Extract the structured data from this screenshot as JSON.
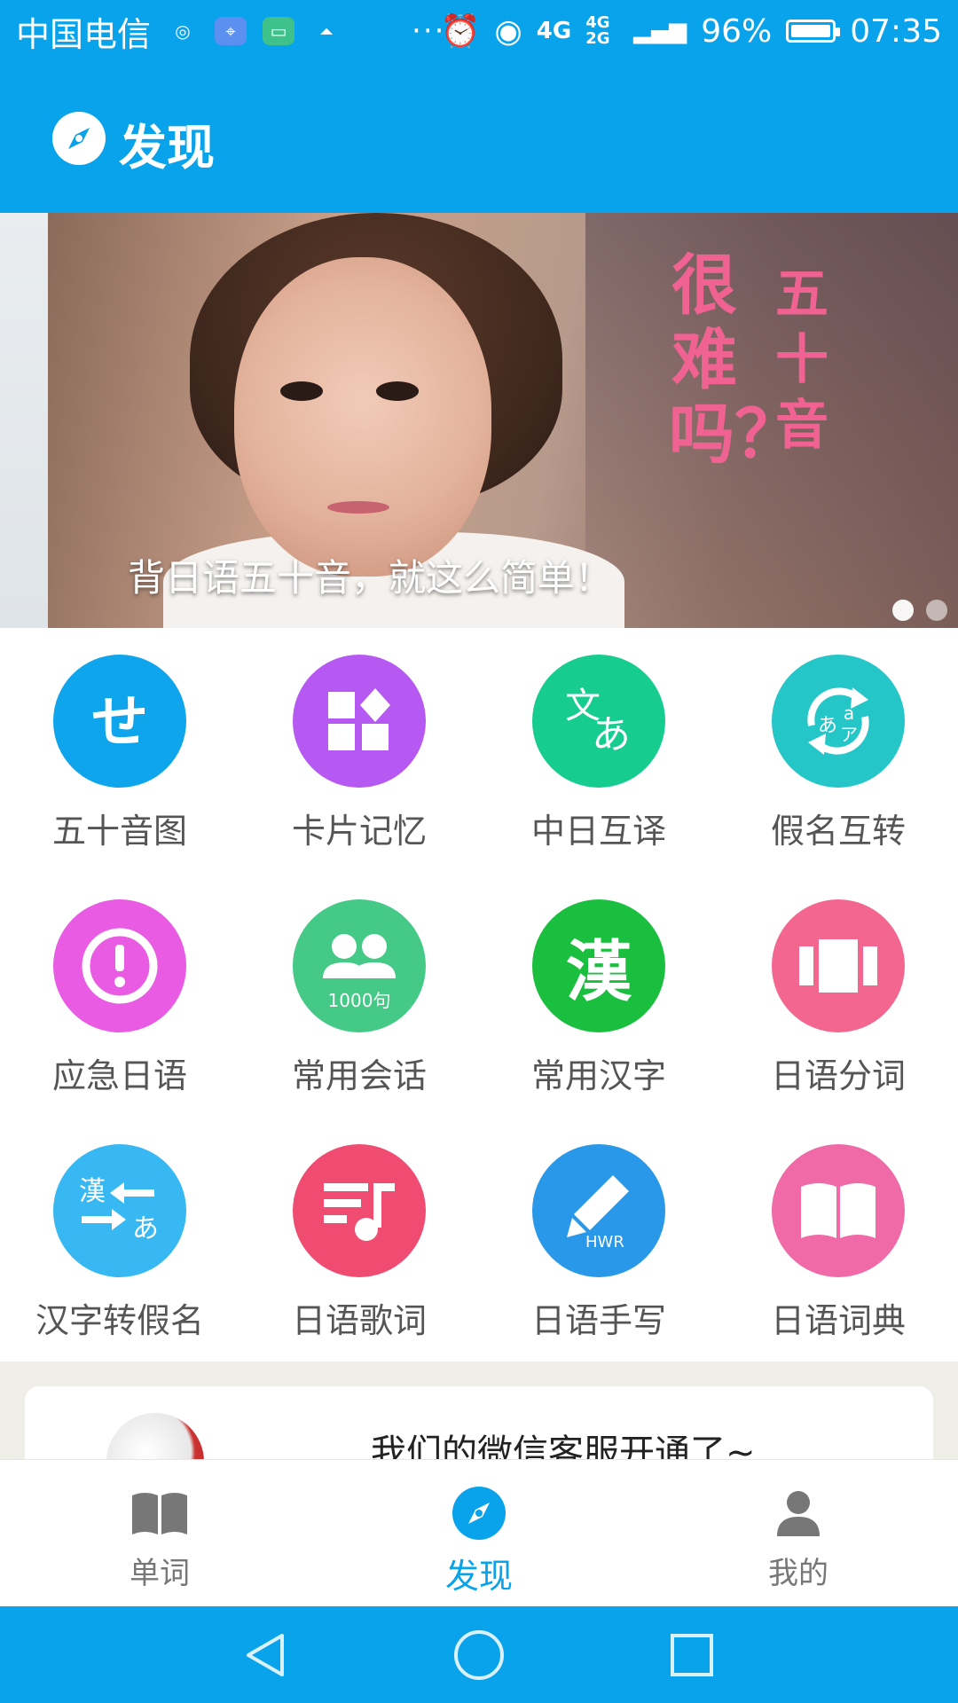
{
  "status_bar": {
    "carrier": "中国电信",
    "network_4g": "4G",
    "network_4g2g": "4G 2G",
    "battery_percent": "96%",
    "time": "07:35",
    "more": "···"
  },
  "app_bar": {
    "title": "发现",
    "icon": "compass-icon"
  },
  "banner": {
    "caption": "背日语五十音，就这么简单！",
    "deco_text_1": "很难吗？",
    "deco_text_2": "五十音",
    "page_count": 2,
    "active_page": 1
  },
  "features": [
    {
      "label": "五十音图",
      "icon": "kana-se-icon",
      "color": "#0ea5ec"
    },
    {
      "label": "卡片记忆",
      "icon": "cards-icon",
      "color": "#b658f2"
    },
    {
      "label": "中日互译",
      "icon": "translate-icon",
      "color": "#16cc8f"
    },
    {
      "label": "假名互转",
      "icon": "kana-convert-icon",
      "color": "#25c6c7"
    },
    {
      "label": "应急日语",
      "icon": "alert-icon",
      "color": "#e85be2"
    },
    {
      "label": "常用会话",
      "icon": "conversation-icon",
      "color": "#44c986",
      "badge": "1000句"
    },
    {
      "label": "常用汉字",
      "icon": "kanji-icon",
      "color": "#1bbf3f",
      "glyph": "漢"
    },
    {
      "label": "日语分词",
      "icon": "segment-icon",
      "color": "#f2668f"
    },
    {
      "label": "汉字转假名",
      "icon": "kanji-to-kana-icon",
      "color": "#38b8f3",
      "glyph_a": "漢",
      "glyph_b": "あ"
    },
    {
      "label": "日语歌词",
      "icon": "lyrics-icon",
      "color": "#f04c72"
    },
    {
      "label": "日语手写",
      "icon": "handwriting-icon",
      "color": "#2a98e8",
      "badge": "HWR"
    },
    {
      "label": "日语词典",
      "icon": "dictionary-icon",
      "color": "#f06aa8"
    }
  ],
  "notice": {
    "text": "我们的微信客服开通了~"
  },
  "tabs": [
    {
      "label": "单词",
      "icon": "book-icon",
      "active": false
    },
    {
      "label": "发现",
      "icon": "compass-icon",
      "active": true
    },
    {
      "label": "我的",
      "icon": "person-icon",
      "active": false
    }
  ],
  "colors": {
    "primary": "#08a3ea",
    "tab_inactive": "#777777",
    "label_text": "#555555"
  }
}
